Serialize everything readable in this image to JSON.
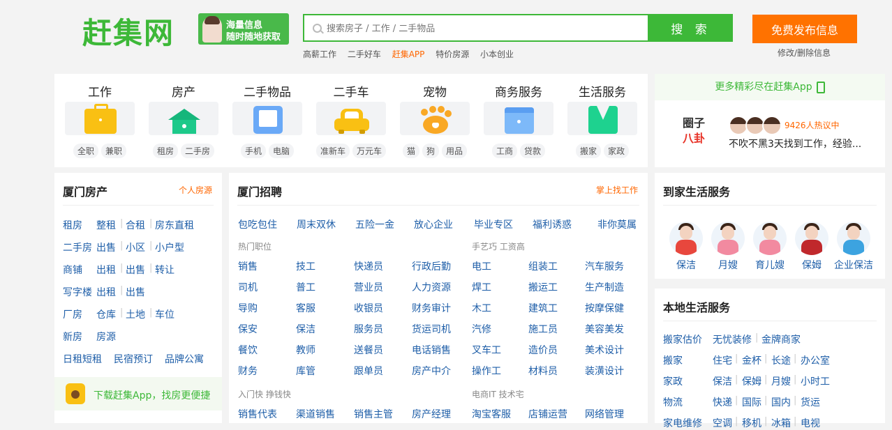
{
  "header": {
    "logo": "赶集网",
    "promo": {
      "line1": "海量信息",
      "line2": "随时随地获取"
    },
    "search_placeholder": "搜索房子 / 工作 / 二手物品",
    "search_button": "搜 索",
    "hot_links": [
      "高薪工作",
      "二手好车",
      "赶集APP",
      "特价房源",
      "小本创业"
    ],
    "publish_button": "免费发布信息",
    "edit_link": "修改/删除信息"
  },
  "categories": [
    {
      "title": "工作",
      "icon": "briefcase-icon",
      "tags": [
        "全职",
        "兼职"
      ]
    },
    {
      "title": "房产",
      "icon": "house-icon",
      "tags": [
        "租房",
        "二手房"
      ]
    },
    {
      "title": "二手物品",
      "icon": "phone-icon",
      "tags": [
        "手机",
        "电脑"
      ]
    },
    {
      "title": "二手车",
      "icon": "car-icon",
      "tags": [
        "准新车",
        "万元车"
      ]
    },
    {
      "title": "宠物",
      "icon": "paw-icon",
      "tags": [
        "猫",
        "狗",
        "用品"
      ]
    },
    {
      "title": "商务服务",
      "icon": "folder-icon",
      "tags": [
        "工商",
        "贷款"
      ]
    },
    {
      "title": "生活服务",
      "icon": "vest-icon",
      "tags": [
        "搬家",
        "家政"
      ]
    }
  ],
  "app_card": {
    "banner": "更多精彩尽在赶集App",
    "quanzi_line1": "圈子",
    "quanzi_line2": "八卦",
    "hot_count": "9426人热议中",
    "topic": "不吹不黑3天找到工作，经验..."
  },
  "house": {
    "title": "厦门房产",
    "more": "个人房源",
    "rows": [
      [
        "租房",
        "整租",
        "合租",
        "房东直租"
      ],
      [
        "二手房",
        "出售",
        "小区",
        "小户型"
      ],
      [
        "商铺",
        "出租",
        "出售",
        "转让"
      ],
      [
        "写字楼",
        "出租",
        "出售"
      ],
      [
        "厂房",
        "仓库",
        "土地",
        "车位"
      ],
      [
        "新房",
        "房源"
      ],
      [
        "日租短租",
        "民宿预订",
        "品牌公寓"
      ]
    ],
    "app_download": "下载赶集App，找房更便捷"
  },
  "jobs": {
    "title": "厦门招聘",
    "more": "掌上找工作",
    "top_links": [
      "包吃包住",
      "周末双休",
      "五险一金",
      "放心企业",
      "毕业专区",
      "福利诱惑",
      "非你莫属"
    ],
    "sub1": "热门职位",
    "sub2": "手艺巧 工资高",
    "grid_left": [
      [
        "销售",
        "技工",
        "快递员",
        "行政后勤"
      ],
      [
        "司机",
        "普工",
        "营业员",
        "人力资源"
      ],
      [
        "导购",
        "客服",
        "收银员",
        "财务审计"
      ],
      [
        "保安",
        "保洁",
        "服务员",
        "货运司机"
      ],
      [
        "餐饮",
        "教师",
        "送餐员",
        "电话销售"
      ],
      [
        "财务",
        "库管",
        "跟单员",
        "房产中介"
      ]
    ],
    "grid_right": [
      [
        "电工",
        "组装工",
        "汽车服务"
      ],
      [
        "焊工",
        "搬运工",
        "生产制造"
      ],
      [
        "木工",
        "建筑工",
        "按摩保健"
      ],
      [
        "汽修",
        "施工员",
        "美容美发"
      ],
      [
        "叉车工",
        "造价员",
        "美术设计"
      ],
      [
        "操作工",
        "材料员",
        "装潢设计"
      ]
    ],
    "sub3": "入门快 挣钱快",
    "sub4": "电商IT 技术宅",
    "bottom_left": [
      "销售代表",
      "渠道销售",
      "销售主管",
      "房产经理"
    ],
    "bottom_right": [
      "淘宝客服",
      "店铺运营",
      "网络管理"
    ]
  },
  "home_service": {
    "title": "到家生活服务",
    "people": [
      {
        "label": "保洁",
        "color": "#e8473d"
      },
      {
        "label": "月嫂",
        "color": "#f28aa0"
      },
      {
        "label": "育儿嫂",
        "color": "#f28aa0"
      },
      {
        "label": "保姆",
        "color": "#c0282c"
      },
      {
        "label": "企业保洁",
        "color": "#3ca3e0"
      }
    ]
  },
  "local_service": {
    "title": "本地生活服务",
    "rows": [
      [
        "搬家估价",
        "无忧装修",
        "金牌商家"
      ],
      [
        "搬家",
        "住宅",
        "金杯",
        "长途",
        "办公室"
      ],
      [
        "家政",
        "保洁",
        "保姆",
        "月嫂",
        "小时工"
      ],
      [
        "物流",
        "快递",
        "国际",
        "国内",
        "货运"
      ],
      [
        "家电维修",
        "空调",
        "移机",
        "冰箱",
        "电视"
      ]
    ]
  },
  "colors": {
    "brand_green": "#3db838",
    "accent_orange": "#ff7200",
    "link_blue": "#1e5ea8"
  }
}
